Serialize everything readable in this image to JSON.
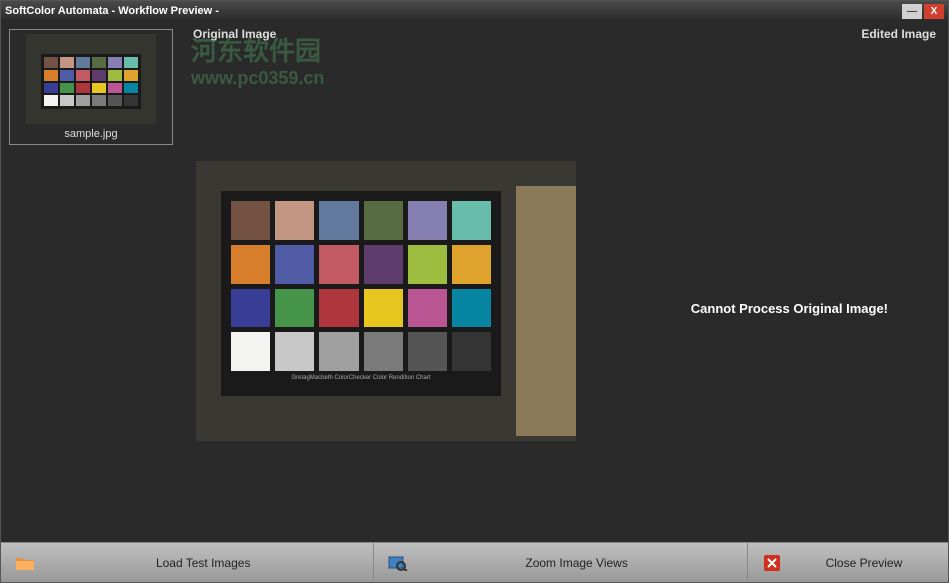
{
  "window": {
    "title": "SoftColor Automata - Workflow Preview -"
  },
  "sidebar": {
    "thumbnail_label": "sample.jpg"
  },
  "headers": {
    "original": "Original Image",
    "edited": "Edited Image"
  },
  "error_message": "Cannot Process Original Image!",
  "chart_caption": "GretagMacbeth ColorChecker Color Rendition Chart",
  "watermark": {
    "text1": "河东软件园",
    "text2": "www.pc0359.cn"
  },
  "toolbar": {
    "load": "Load Test Images",
    "zoom": "Zoom Image Views",
    "close": "Close Preview"
  },
  "colorchecker": [
    "#735244",
    "#c29682",
    "#627a9d",
    "#576c43",
    "#8580b1",
    "#67bdaa",
    "#d67e2c",
    "#505ba6",
    "#c15a63",
    "#5e3c6c",
    "#9dbc40",
    "#e0a32e",
    "#383d96",
    "#469449",
    "#af363c",
    "#e7c71f",
    "#bb5695",
    "#0885a1",
    "#f3f3f2",
    "#c8c8c8",
    "#a0a0a0",
    "#7a7a7a",
    "#555555",
    "#343434"
  ]
}
